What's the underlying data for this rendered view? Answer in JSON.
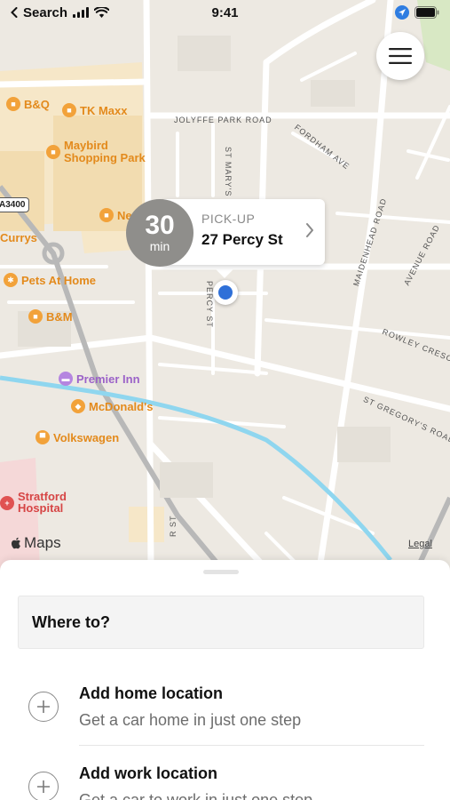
{
  "status_bar": {
    "back_label": "Search",
    "time": "9:41"
  },
  "map": {
    "pois": {
      "bq": "B&Q",
      "tkmaxx": "TK Maxx",
      "maybird": "Maybird\nShopping Park",
      "next": "Ne",
      "currys": "Currys",
      "pets": "Pets At Home",
      "bm": "B&M",
      "premier": "Premier Inn",
      "mcdonalds": "McDonald's",
      "vw": "Volkswagen",
      "hospital": "Stratford\nHospital"
    },
    "streets": {
      "jolyffe": "Jolyffe Park Road",
      "stmarys": "St Mary's Road",
      "fordham": "Fordham Ave",
      "maidenhead": "Maidenhead Road",
      "avenue": "Avenue Road",
      "rowley": "Rowley Cresc",
      "stgregory": "St Gregory's Road",
      "percy": "Percy St",
      "bottom": "R ST"
    },
    "road_badge": "A3400",
    "maps_label": "Maps",
    "legal": "Legal"
  },
  "pickup": {
    "eta_value": "30",
    "eta_unit": "min",
    "label": "PICK-UP",
    "address": "27 Percy St"
  },
  "sheet": {
    "search_placeholder": "Where to?",
    "items": [
      {
        "title": "Add home location",
        "subtitle": "Get a car home in just one step"
      },
      {
        "title": "Add work location",
        "subtitle": "Get a car to work in just one step"
      }
    ]
  },
  "colors": {
    "river": "#8fd6ef",
    "poi_orange": "#f2a23a",
    "poi_purple": "#b585e0",
    "pin_blue": "#2f70d8",
    "eta_gray": "#8f8e8b"
  }
}
